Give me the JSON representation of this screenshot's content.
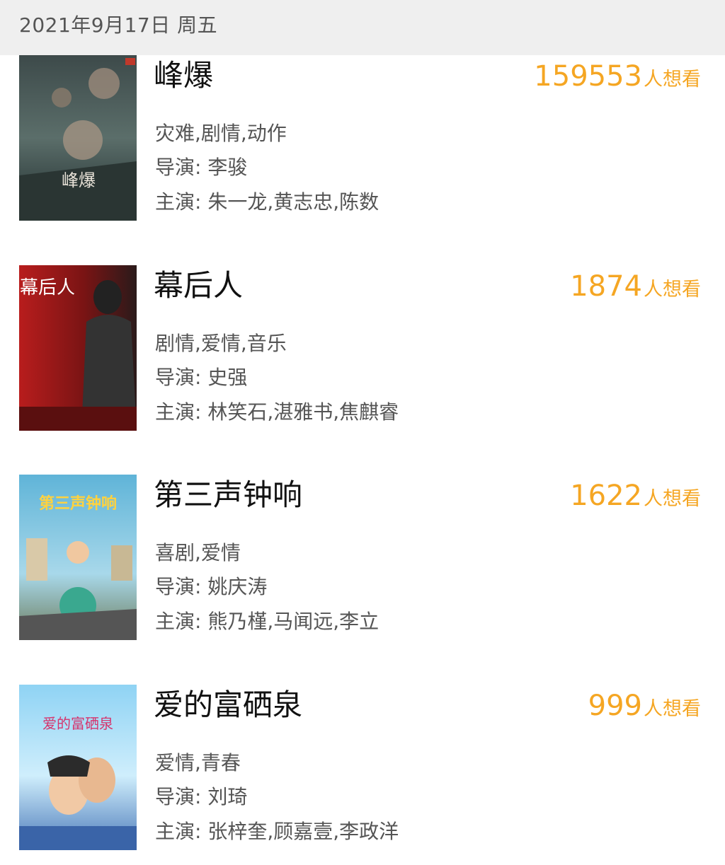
{
  "header": {
    "date": "2021年9月17日 周五"
  },
  "want_suffix": "人想看",
  "movies": [
    {
      "title": "峰爆",
      "want_count": "159553",
      "genres": "灾难,剧情,动作",
      "director": "导演: 李骏",
      "cast": "主演: 朱一龙,黄志忠,陈数",
      "poster_text": "峰爆"
    },
    {
      "title": "幕后人",
      "want_count": "1874",
      "genres": "剧情,爱情,音乐",
      "director": "导演: 史强",
      "cast": "主演: 林笑石,湛雅书,焦麒睿",
      "poster_text": "幕后人"
    },
    {
      "title": "第三声钟响",
      "want_count": "1622",
      "genres": "喜剧,爱情",
      "director": "导演: 姚庆涛",
      "cast": "主演: 熊乃槿,马闻远,李立",
      "poster_text": "第三声钟响"
    },
    {
      "title": "爱的富硒泉",
      "want_count": "999",
      "genres": "爱情,青春",
      "director": "导演: 刘琦",
      "cast": "主演: 张梓奎,顾嘉壹,李政洋",
      "poster_text": "爱的富硒泉"
    }
  ]
}
